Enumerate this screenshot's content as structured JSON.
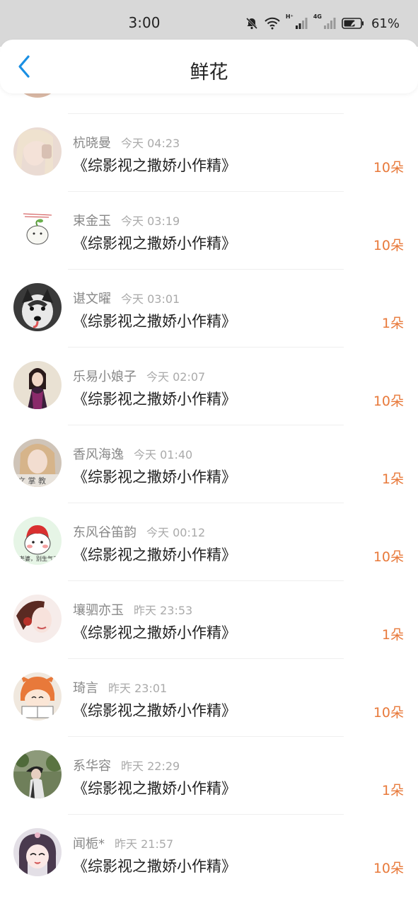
{
  "status_bar": {
    "time": "3:00",
    "network_label": "H⁺",
    "network_label_2": "4G",
    "battery_percent": "61%",
    "icons": [
      "bell-off-icon",
      "wifi-icon",
      "signal-icon",
      "signal-icon",
      "battery-icon"
    ]
  },
  "header": {
    "title": "鲜花",
    "back_icon": "chevron-left-icon"
  },
  "colors": {
    "accent": "#1a8fe3",
    "amount": "#e8793a",
    "status_bar_bg": "#d8d8d8"
  },
  "items": [
    {
      "name": "杭晓曼",
      "time": "今天 04:23",
      "book": "《综影视之撒娇小作精》",
      "amount": "10朵"
    },
    {
      "name": "束金玉",
      "time": "今天 03:19",
      "book": "《综影视之撒娇小作精》",
      "amount": "10朵"
    },
    {
      "name": "谌文曜",
      "time": "今天 03:01",
      "book": "《综影视之撒娇小作精》",
      "amount": "1朵"
    },
    {
      "name": "乐易小娘子",
      "time": "今天 02:07",
      "book": "《综影视之撒娇小作精》",
      "amount": "10朵"
    },
    {
      "name": "香风海逸",
      "time": "今天 01:40",
      "book": "《综影视之撒娇小作精》",
      "amount": "1朵"
    },
    {
      "name": "东风谷笛韵",
      "time": "今天 00:12",
      "book": "《综影视之撒娇小作精》",
      "amount": "10朵"
    },
    {
      "name": "壤驷亦玉",
      "time": "昨天 23:53",
      "book": "《综影视之撒娇小作精》",
      "amount": "1朵"
    },
    {
      "name": "琦言",
      "time": "昨天 23:01",
      "book": "《综影视之撒娇小作精》",
      "amount": "10朵"
    },
    {
      "name": "系华容",
      "time": "昨天 22:29",
      "book": "《综影视之撒娇小作精》",
      "amount": "1朵"
    },
    {
      "name": "闻栀*",
      "time": "昨天 21:57",
      "book": "《综影视之撒娇小作精》",
      "amount": "10朵"
    }
  ]
}
